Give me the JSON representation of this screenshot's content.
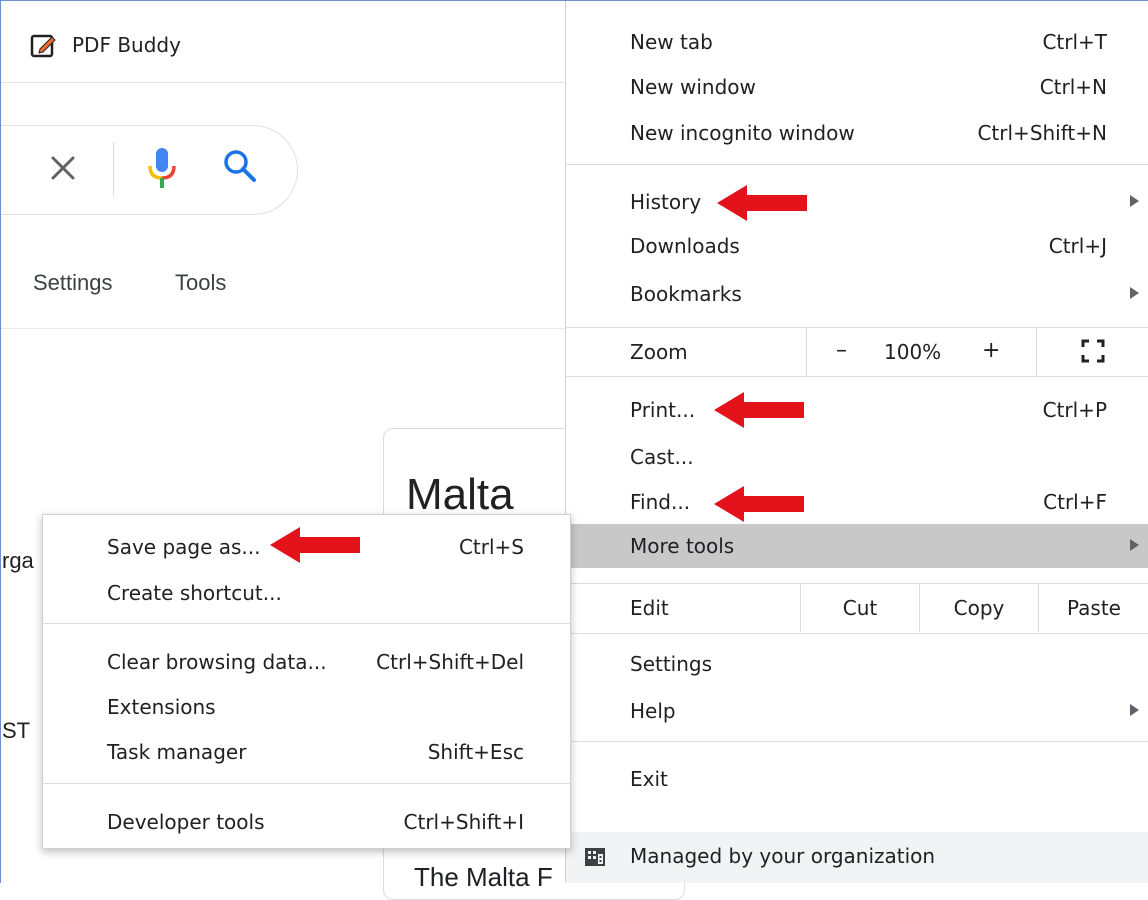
{
  "colors": {
    "accent_red": "#e3121b",
    "menu_highlight": "#c8c8c8",
    "search_blue": "#1a73e8"
  },
  "bookmark": {
    "label": "PDF Buddy",
    "icon": "pdf-buddy-pencil-icon"
  },
  "search": {
    "icons": [
      "clear-icon",
      "mic-icon",
      "search-icon"
    ]
  },
  "toolbar": {
    "settings": "Settings",
    "tools": "Tools"
  },
  "page": {
    "card_title": "Malta",
    "card_subtitle": "The Malta F",
    "fragment_1": "rga",
    "fragment_2": "ST"
  },
  "menu": {
    "new_tab": {
      "label": "New tab",
      "shortcut": "Ctrl+T"
    },
    "new_window": {
      "label": "New window",
      "shortcut": "Ctrl+N"
    },
    "new_incognito": {
      "label": "New incognito window",
      "shortcut": "Ctrl+Shift+N"
    },
    "history": {
      "label": "History"
    },
    "downloads": {
      "label": "Downloads",
      "shortcut": "Ctrl+J"
    },
    "bookmarks": {
      "label": "Bookmarks"
    },
    "zoom": {
      "label": "Zoom",
      "minus": "–",
      "value": "100%",
      "plus": "+"
    },
    "print": {
      "label": "Print...",
      "shortcut": "Ctrl+P"
    },
    "cast": {
      "label": "Cast..."
    },
    "find": {
      "label": "Find...",
      "shortcut": "Ctrl+F"
    },
    "more_tools": {
      "label": "More tools"
    },
    "edit": {
      "label": "Edit",
      "cut": "Cut",
      "copy": "Copy",
      "paste": "Paste"
    },
    "settings": {
      "label": "Settings"
    },
    "help": {
      "label": "Help"
    },
    "exit": {
      "label": "Exit"
    },
    "managed": {
      "label": "Managed by your organization"
    }
  },
  "submenu": {
    "save_page": {
      "label": "Save page as...",
      "shortcut": "Ctrl+S"
    },
    "create_shortcut": {
      "label": "Create shortcut..."
    },
    "clear_data": {
      "label": "Clear browsing data...",
      "shortcut": "Ctrl+Shift+Del"
    },
    "extensions": {
      "label": "Extensions"
    },
    "task_manager": {
      "label": "Task manager",
      "shortcut": "Shift+Esc"
    },
    "dev_tools": {
      "label": "Developer tools",
      "shortcut": "Ctrl+Shift+I"
    }
  }
}
